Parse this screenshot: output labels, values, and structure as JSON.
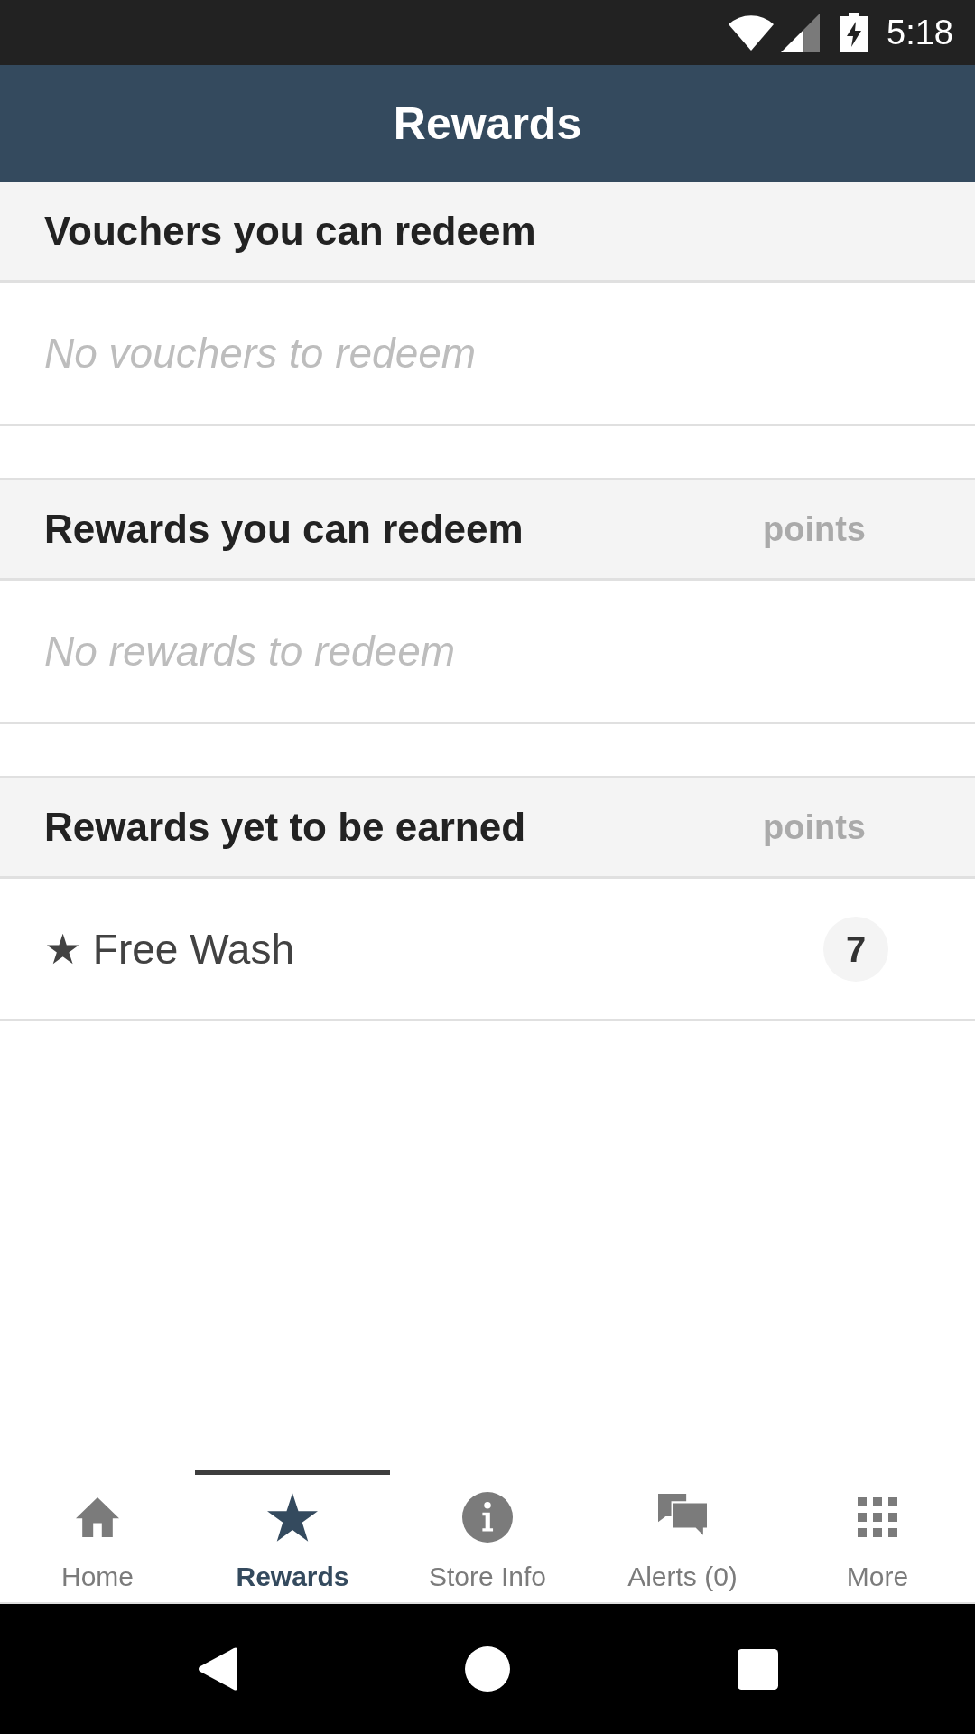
{
  "status_bar": {
    "time": "5:18"
  },
  "app_bar": {
    "title": "Rewards"
  },
  "sections": [
    {
      "title": "Vouchers you can redeem",
      "empty_message": "No vouchers to redeem"
    },
    {
      "title": "Rewards you can redeem",
      "column_label": "points",
      "empty_message": "No rewards to redeem"
    },
    {
      "title": "Rewards yet to be earned",
      "column_label": "points",
      "items": [
        {
          "name": "★ Free Wash",
          "points": "7"
        }
      ]
    }
  ],
  "bottom_nav": {
    "tabs": [
      {
        "label": "Home",
        "selected": false
      },
      {
        "label": "Rewards",
        "selected": true
      },
      {
        "label": "Store Info",
        "selected": false
      },
      {
        "label": "Alerts (0)",
        "selected": false
      },
      {
        "label": "More",
        "selected": false
      }
    ]
  }
}
